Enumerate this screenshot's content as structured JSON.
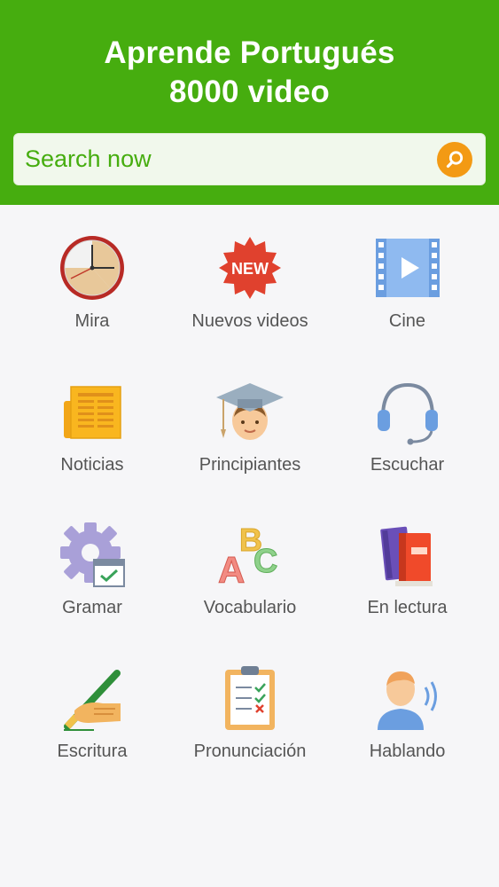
{
  "header": {
    "title_line1": "Aprende Portugués",
    "title_line2": "8000 video",
    "background_color": "#46ad0f"
  },
  "search": {
    "placeholder": "Search now",
    "button_icon": "search-icon",
    "button_color": "#f39a14"
  },
  "menu": [
    {
      "label": "Mira",
      "icon": "clock-icon"
    },
    {
      "label": "Nuevos videos",
      "icon": "new-badge-icon"
    },
    {
      "label": "Cine",
      "icon": "film-play-icon"
    },
    {
      "label": "Noticias",
      "icon": "newspaper-icon"
    },
    {
      "label": "Principiantes",
      "icon": "graduate-icon"
    },
    {
      "label": "Escuchar",
      "icon": "headset-icon"
    },
    {
      "label": "Gramar",
      "icon": "gear-calendar-icon"
    },
    {
      "label": "Vocabulario",
      "icon": "abc-icon"
    },
    {
      "label": "En lectura",
      "icon": "books-icon"
    },
    {
      "label": "Escritura",
      "icon": "writing-hand-icon"
    },
    {
      "label": "Pronunciación",
      "icon": "clipboard-checklist-icon"
    },
    {
      "label": "Hablando",
      "icon": "speaking-person-icon"
    }
  ]
}
